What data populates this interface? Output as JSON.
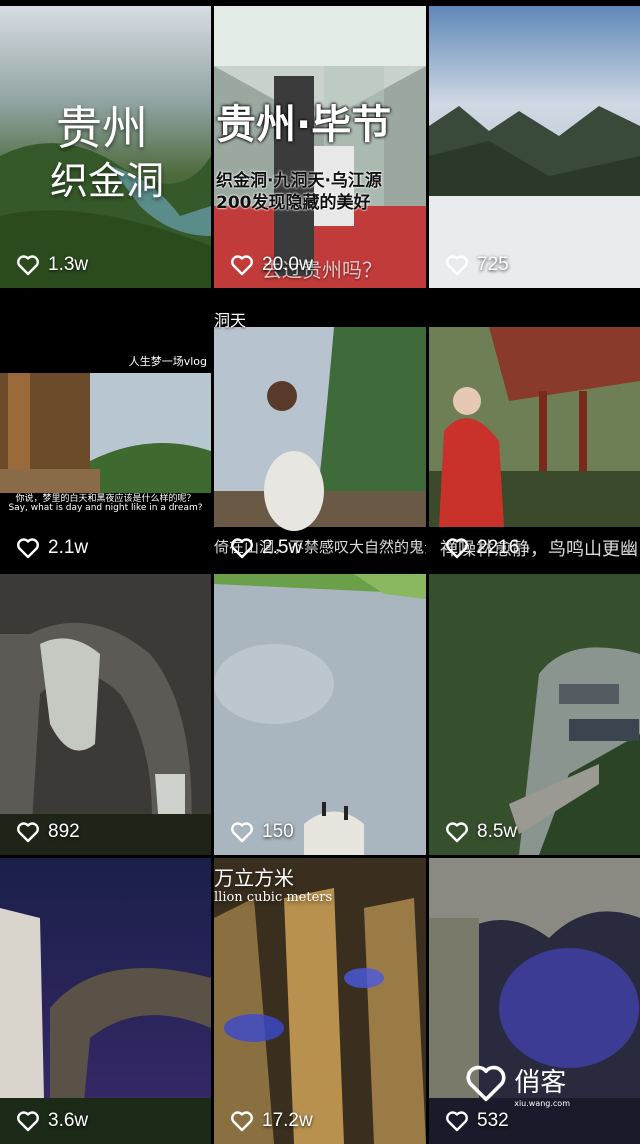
{
  "tiles": [
    {
      "likes": "1.3w",
      "title_line1": "贵州",
      "title_line2": "织金洞"
    },
    {
      "likes": "20.0w",
      "banner": "贵州·毕节",
      "sub1": "织金洞·九洞天·乌江源",
      "sub2": "200发现隐藏的美好",
      "caption": "去过贵州吗？"
    },
    {
      "likes": "725"
    },
    {
      "likes": "2.1w",
      "top_tag": "人生梦一场vlog",
      "caption_cn": "你说，梦里的白天和黑夜应该是什么样的呢？",
      "caption_en": "Say, what is day and night like in a dream?"
    },
    {
      "likes": "2.5w",
      "top_tag": "洞天",
      "caption": "倚在山洞，不禁感叹大自然的鬼斧神工"
    },
    {
      "likes": "2216",
      "caption": "禅噪林愈静，鸟鸣山更幽"
    },
    {
      "likes": "892"
    },
    {
      "likes": "150"
    },
    {
      "likes": "8.5w"
    },
    {
      "likes": "3.6w"
    },
    {
      "likes": "17.2w",
      "caption_cn": "万立方米",
      "caption_en": "llion cubic meters"
    },
    {
      "likes": "532",
      "watermark": "俏客",
      "watermark_sub": "xiu.wang.com"
    }
  ]
}
